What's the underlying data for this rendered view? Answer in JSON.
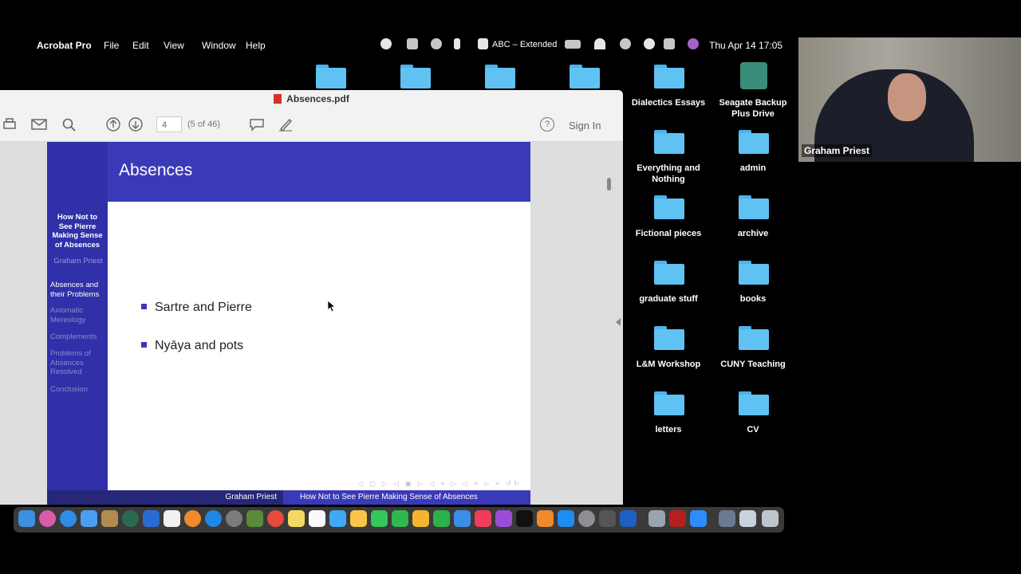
{
  "menubar": {
    "app_name": "Acrobat Pro",
    "menus": [
      "File",
      "Edit",
      "View",
      "Window",
      "Help"
    ],
    "input_source": "ABC – Extended",
    "datetime": "Thu Apr 14  17:05"
  },
  "desktop": {
    "items": [
      {
        "label": "Dialectics Essays"
      },
      {
        "label": "Seagate Backup Plus Drive"
      },
      {
        "label": "Everything and Nothing"
      },
      {
        "label": "admin"
      },
      {
        "label": "Fictional pieces"
      },
      {
        "label": "archive"
      },
      {
        "label": "graduate stuff"
      },
      {
        "label": "books"
      },
      {
        "label": "L&M Workshop"
      },
      {
        "label": "CUNY Teaching"
      },
      {
        "label": "letters"
      },
      {
        "label": "CV"
      }
    ]
  },
  "window": {
    "title": "Absences.pdf",
    "page_input": "4",
    "page_count": "(5 of 46)",
    "sign_in": "Sign In"
  },
  "slide": {
    "title": "Absences",
    "sidebar": {
      "talk_title": "How Not to See Pierre Making Sense of Absences",
      "author": "Graham Priest",
      "sections": [
        {
          "label": "Absences and their Problems",
          "active": true
        },
        {
          "label": "Axiomatic Mereology",
          "active": false
        },
        {
          "label": "Complements",
          "active": false
        },
        {
          "label": "Problems of Absences Resolved",
          "active": false
        },
        {
          "label": "Conclusion",
          "active": false
        }
      ]
    },
    "bullets": [
      "Sartre and Pierre",
      "Nyāya and pots"
    ],
    "footer": {
      "author": "Graham Priest",
      "talk_title": "How Not to See Pierre Making Sense of Absences"
    }
  },
  "camera": {
    "participant_name": "Graham Priest"
  },
  "colors": {
    "slide_header": "#3a3ab8",
    "slide_sidebar": "#3030a8",
    "folder": "#5fc2f3"
  }
}
